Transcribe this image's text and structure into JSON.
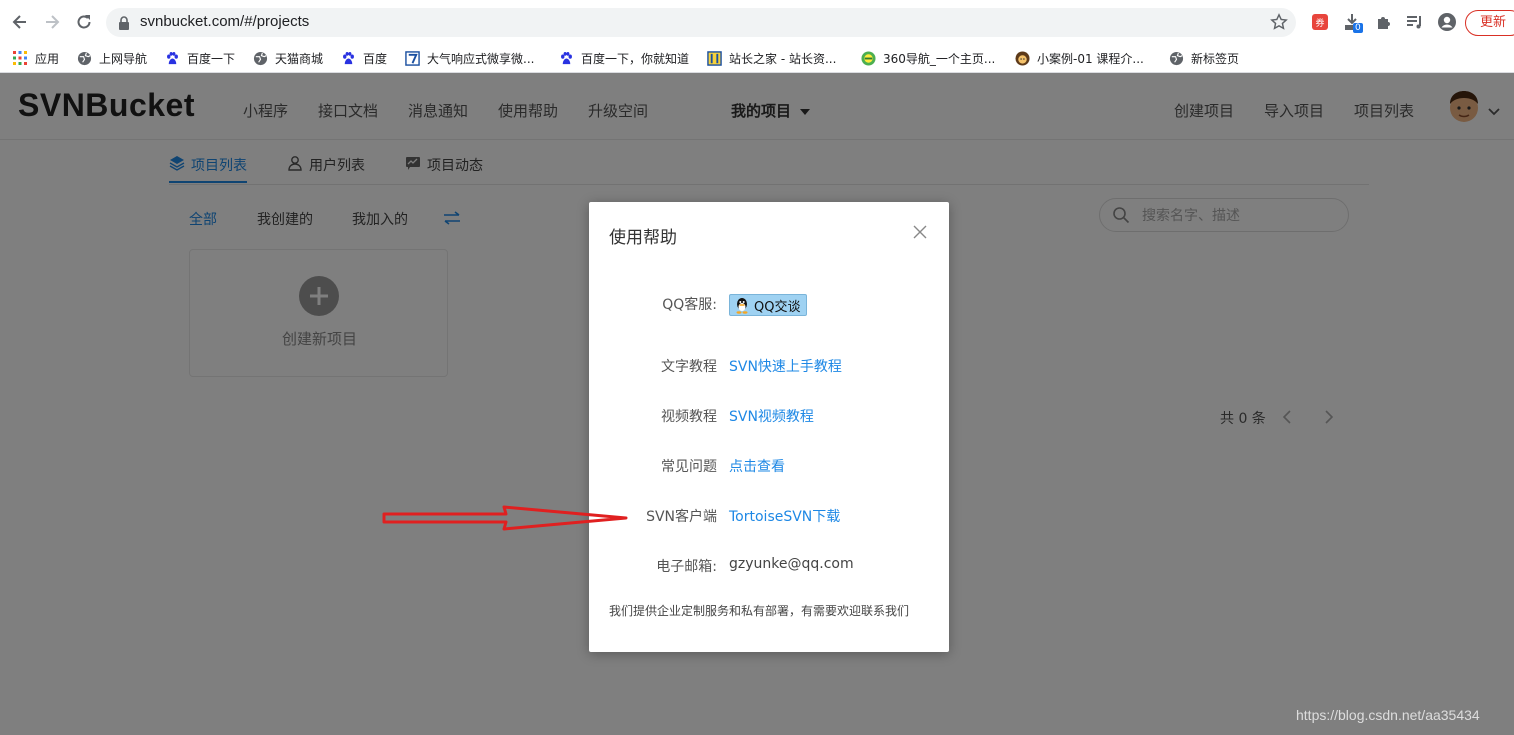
{
  "browser": {
    "url": "svnbucket.com/#/projects",
    "update_label": "更新",
    "extension_badge": "0",
    "coupon_label": "券"
  },
  "bookmarks": [
    {
      "label": "应用",
      "icon": "apps-grid-icon"
    },
    {
      "label": "上网导航",
      "icon": "globe-icon"
    },
    {
      "label": "百度一下",
      "icon": "baidu-paw-icon"
    },
    {
      "label": "天猫商城",
      "icon": "globe-icon"
    },
    {
      "label": "百度",
      "icon": "baidu-paw-icon"
    },
    {
      "label": "大气响应式微享微...",
      "icon": "site-icon"
    },
    {
      "label": "百度一下，你就知道",
      "icon": "baidu-paw-icon"
    },
    {
      "label": "站长之家 - 站长资...",
      "icon": "site-icon"
    },
    {
      "label": "360导航_一个主页...",
      "icon": "360-icon"
    },
    {
      "label": "小案例-01 课程介...",
      "icon": "avatar-icon"
    },
    {
      "label": "新标签页",
      "icon": "globe-icon"
    }
  ],
  "header": {
    "logo": "SVNBucket",
    "nav_left": [
      "小程序",
      "接口文档",
      "消息通知",
      "使用帮助",
      "升级空间"
    ],
    "my_projects": "我的项目",
    "nav_right": [
      "创建项目",
      "导入项目",
      "项目列表"
    ]
  },
  "subtabs": [
    "项目列表",
    "用户列表",
    "项目动态"
  ],
  "filters": [
    "全部",
    "我创建的",
    "我加入的"
  ],
  "search": {
    "placeholder": "搜索名字、描述"
  },
  "new_project": {
    "label": "创建新项目"
  },
  "pager": {
    "total": "共 0 条"
  },
  "modal": {
    "title": "使用帮助",
    "qq_label": "QQ客服:",
    "qq_button": "QQ交谈",
    "rows": [
      {
        "label": "文字教程",
        "value": "SVN快速上手教程"
      },
      {
        "label": "视频教程",
        "value": "SVN视频教程"
      },
      {
        "label": "常见问题",
        "value": "点击查看"
      },
      {
        "label": "SVN客户端",
        "value": "TortoiseSVN下载"
      }
    ],
    "email_label": "电子邮箱:",
    "email_value": "gzyunke@qq.com",
    "footer": "我们提供企业定制服务和私有部署，有需要欢迎联系我们"
  },
  "watermark": "https://blog.csdn.net/aa35434",
  "colors": {
    "accent": "#1e88e5",
    "arrow": "#e02020",
    "overlay": "rgba(0,0,0,0.5)"
  }
}
